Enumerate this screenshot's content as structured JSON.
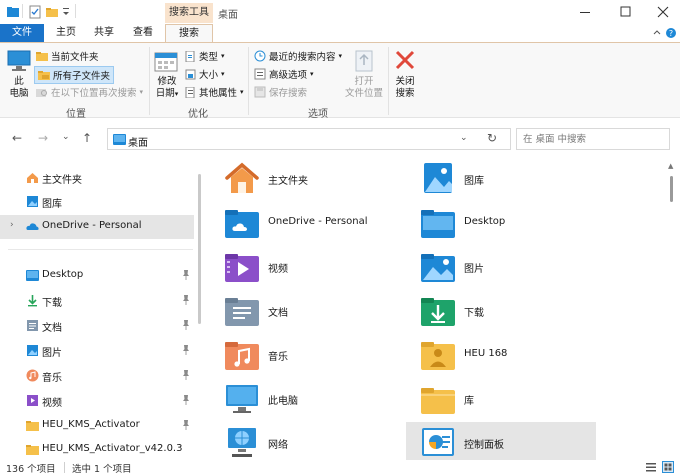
{
  "window": {
    "context_tab_header": "搜索工具",
    "title": "桌面"
  },
  "ribbon": {
    "tabs": {
      "file": "文件",
      "home": "主页",
      "share": "共享",
      "view": "查看",
      "search": "搜索"
    },
    "location": {
      "this_pc_line1": "此",
      "this_pc_line2": "电脑",
      "current_folder": "当前文件夹",
      "all_subfolders": "所有子文件夹",
      "search_again": "在以下位置再次搜索",
      "group_label": "位置"
    },
    "refine": {
      "modified_line1": "修改",
      "modified_line2": "日期",
      "type": "类型",
      "size": "大小",
      "other_props": "其他属性",
      "group_label": "优化"
    },
    "options": {
      "recent": "最近的搜索内容",
      "advanced": "高级选项",
      "save": "保存搜索",
      "group_label": "选项"
    },
    "open_location_line1": "打开",
    "open_location_line2": "文件位置",
    "close_line1": "关闭",
    "close_line2": "搜索"
  },
  "address": {
    "path": "桌面",
    "search_placeholder": "在 桌面 中搜索"
  },
  "nav": {
    "items": [
      {
        "label": "主文件夹",
        "icon": "home-icon",
        "pinned": false
      },
      {
        "label": "图库",
        "icon": "gallery-icon",
        "pinned": false
      },
      {
        "label": "OneDrive - Personal",
        "icon": "onedrive-cloud-icon",
        "pinned": false
      },
      {
        "label": "Desktop",
        "icon": "desktop-folder-icon",
        "pinned": true
      },
      {
        "label": "下载",
        "icon": "download-icon",
        "pinned": true
      },
      {
        "label": "文档",
        "icon": "documents-icon",
        "pinned": true
      },
      {
        "label": "图片",
        "icon": "pictures-icon",
        "pinned": true
      },
      {
        "label": "音乐",
        "icon": "music-icon",
        "pinned": true
      },
      {
        "label": "视频",
        "icon": "videos-icon",
        "pinned": true
      },
      {
        "label": "HEU_KMS_Activator",
        "icon": "folder-icon",
        "pinned": true
      },
      {
        "label": "HEU_KMS_Activator_v42.0.3",
        "icon": "folder-icon",
        "pinned": false
      }
    ]
  },
  "content": {
    "items": [
      {
        "label": "主文件夹",
        "icon": "home-icon"
      },
      {
        "label": "图库",
        "icon": "gallery-icon"
      },
      {
        "label": "OneDrive - Personal",
        "icon": "onedrive-folder-icon"
      },
      {
        "label": "Desktop",
        "icon": "desktop-folder-icon"
      },
      {
        "label": "视频",
        "icon": "videos-folder-icon"
      },
      {
        "label": "图片",
        "icon": "pictures-folder-icon"
      },
      {
        "label": "文档",
        "icon": "documents-folder-icon"
      },
      {
        "label": "下载",
        "icon": "downloads-folder-icon"
      },
      {
        "label": "音乐",
        "icon": "music-folder-icon"
      },
      {
        "label": "HEU 168",
        "icon": "user-folder-icon"
      },
      {
        "label": "此电脑",
        "icon": "this-pc-icon"
      },
      {
        "label": "库",
        "icon": "libraries-folder-icon"
      },
      {
        "label": "网络",
        "icon": "network-icon"
      },
      {
        "label": "控制面板",
        "icon": "control-panel-icon"
      }
    ]
  },
  "status": {
    "item_count": "136 个项目",
    "selected": "选中 1 个项目"
  },
  "colors": {
    "accent": "#1a73c9",
    "context_tab": "#f9e3cd",
    "folder_yellow": "#f5c04a",
    "folder_blue": "#1e88d6",
    "selection": "#e5e5e5"
  }
}
